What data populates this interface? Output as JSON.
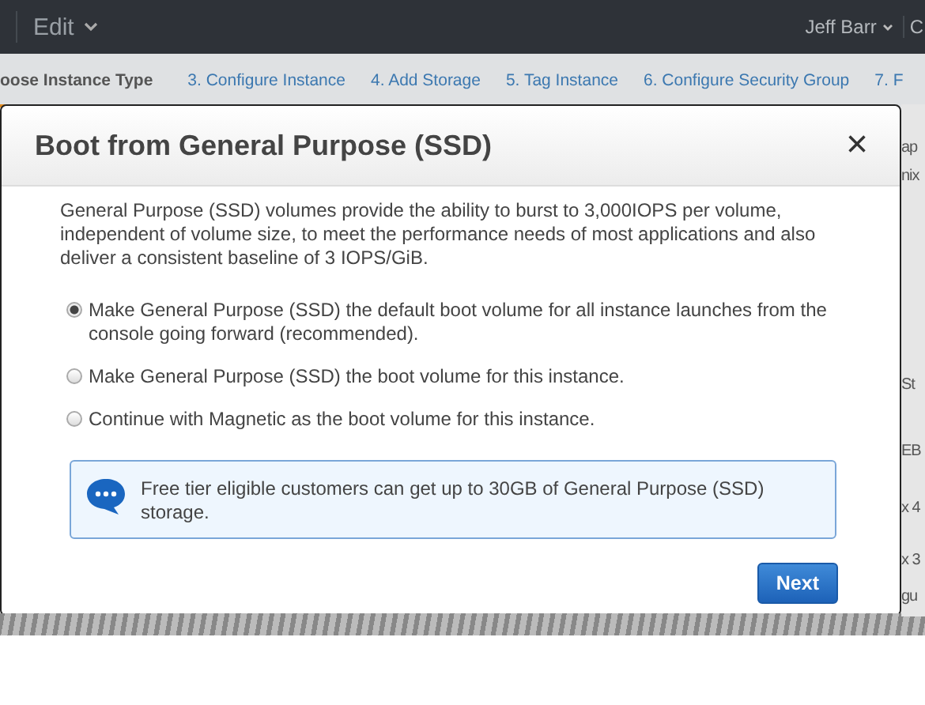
{
  "top_bar": {
    "menu": "Edit",
    "user": "Jeff Barr",
    "cut_item": "C"
  },
  "steps": [
    {
      "label": "oose Instance Type",
      "selected": true
    },
    {
      "label": "3. Configure Instance",
      "selected": false
    },
    {
      "label": "4. Add Storage",
      "selected": false
    },
    {
      "label": "5. Tag Instance",
      "selected": false
    },
    {
      "label": "6. Configure Security Group",
      "selected": false
    },
    {
      "label": "7. F",
      "selected": false
    }
  ],
  "background_fragments": [
    "ap",
    "nix",
    "St",
    "EB",
    "x 4",
    "x 3",
    "gu"
  ],
  "dialog": {
    "title": "Boot from General Purpose (SSD)",
    "close": "×",
    "description": "General Purpose (SSD) volumes provide the ability to burst to 3,000IOPS per volume, independent of volume size, to meet the performance needs of most applications and also deliver a consistent baseline of 3 IOPS/GiB.",
    "options": [
      {
        "label": "Make General Purpose (SSD) the default boot volume for all instance launches from the console going forward (recommended).",
        "selected": true
      },
      {
        "label": "Make General Purpose (SSD) the boot volume for this instance.",
        "selected": false
      },
      {
        "label": "Continue with Magnetic as the boot volume for this instance.",
        "selected": false
      }
    ],
    "info": "Free tier eligible customers can get up to 30GB of General Purpose (SSD) storage.",
    "button": "Next"
  }
}
